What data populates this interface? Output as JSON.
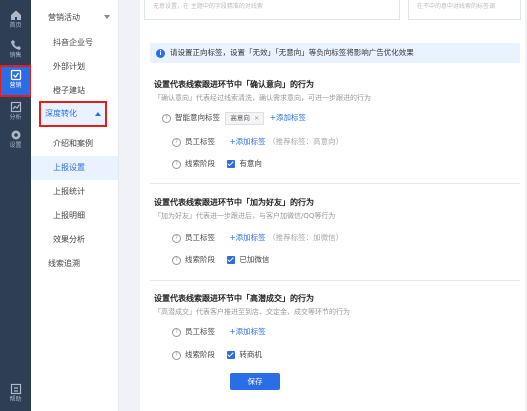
{
  "rail": {
    "items": [
      {
        "label": "首页",
        "icon": "home-icon"
      },
      {
        "label": "销售",
        "icon": "phone-icon"
      },
      {
        "label": "营销",
        "icon": "marketing-icon"
      },
      {
        "label": "分析",
        "icon": "chart-icon"
      },
      {
        "label": "设置",
        "icon": "gear-icon"
      },
      {
        "label": "帮助",
        "icon": "help-icon"
      }
    ]
  },
  "sub": {
    "items": [
      {
        "label": "营销活动"
      },
      {
        "label": "抖音企业号"
      },
      {
        "label": "外部计划"
      },
      {
        "label": "橙子建站"
      },
      {
        "label": "深度转化"
      },
      {
        "label": "介绍和案例"
      },
      {
        "label": "上报设置"
      },
      {
        "label": "上报统计"
      },
      {
        "label": "上报明细"
      },
      {
        "label": "效果分析"
      },
      {
        "label": "线索追溯"
      }
    ]
  },
  "top": {
    "left": "无意设置，在 主题中的字段精准的对线索",
    "right": "在不中的意中对线索的标签调"
  },
  "notice": {
    "text": "请设置正向标签，设置「无效」「无意向」等负向标签将影响广告优化效果"
  },
  "sections": [
    {
      "title": "设置代表线索跟进环节中「确认意向」的行为",
      "desc": "「确认意向」代表经过线索清洗，确认需求意向，可进一步跟进的行为",
      "smart_label": "智能意向标签",
      "smart_tag": "高意向",
      "add_label": "+添加标签",
      "staff_label": "员工标签",
      "staff_add": "+添加标签",
      "staff_hint": "（推荐标签：高意向）",
      "stage_label": "线索阶段",
      "stage_value": "有意向"
    },
    {
      "title": "设置代表线索跟进环节中「加为好友」的行为",
      "desc": "「加为好友」代表进一步跟进后，与客户加微信/QQ等行为",
      "staff_label": "员工标签",
      "staff_add": "+添加标签",
      "staff_hint": "（推荐标签：加微信）",
      "stage_label": "线索阶段",
      "stage_value": "已加微信"
    },
    {
      "title": "设置代表线索跟进环节中「高潜成交」的行为",
      "desc": "「高潜成交」代表客户推进至到店、交定金、成交等环节的行为",
      "staff_label": "员工标签",
      "staff_add": "+添加标签",
      "stage_label": "线索阶段",
      "stage_value": "转商机"
    }
  ],
  "save_label": "保存",
  "colors": {
    "accent": "#2b6de6",
    "rail_bg": "#2d3e55",
    "highlight": "#e0201b"
  }
}
